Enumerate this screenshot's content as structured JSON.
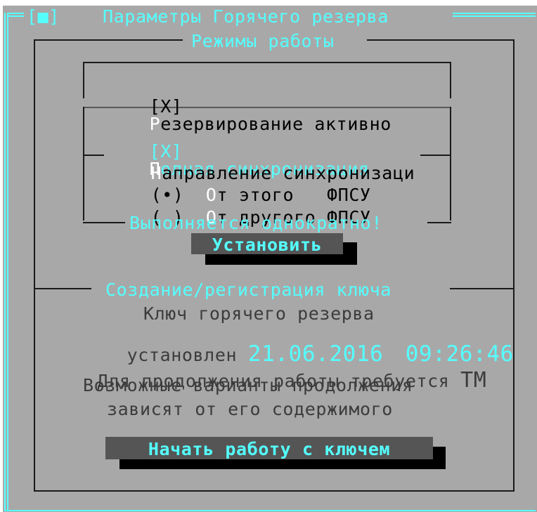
{
  "window": {
    "close_box": "[■]",
    "title": "Параметры Горячего резерва"
  },
  "modes": {
    "title": "Режимы работы",
    "reservation_checkbox": {
      "mark": "[X]",
      "hotkey": "Р",
      "label": "езервирование активно",
      "checked": true
    },
    "full_sync_checkbox": {
      "mark": "[X]",
      "hotkey": "П",
      "label": "олная синхронизация",
      "checked": true
    },
    "direction": {
      "title_hotkey": "Н",
      "title": "аправление синхронизаци",
      "options": [
        {
          "mark": "(•)",
          "hotkey": "О",
          "label": "т этого   ФПСУ",
          "selected": true
        },
        {
          "mark": "( )",
          "hotkey": "О",
          "label": "т другого ФПСУ",
          "selected": false
        }
      ],
      "note": "Выполняется однократно!"
    },
    "set_button": "Установить"
  },
  "key": {
    "title": "Создание/регистрация ключа",
    "line1": "Ключ горячего резерва",
    "line2_prefix": "установлен",
    "date": "21.06.2016",
    "time": "09:26:46",
    "line3": "Для продолжения работы требуется",
    "line3_tm": "ТМ",
    "line4": "Возможные варианты продолжения",
    "line5": "зависят от его содержимого",
    "start_button": "Начать работу с ключем"
  },
  "colors": {
    "background": "#a8a8a8",
    "frame_accent": "#55ffff",
    "button": "#555555",
    "hotkey": "#ffffff"
  }
}
